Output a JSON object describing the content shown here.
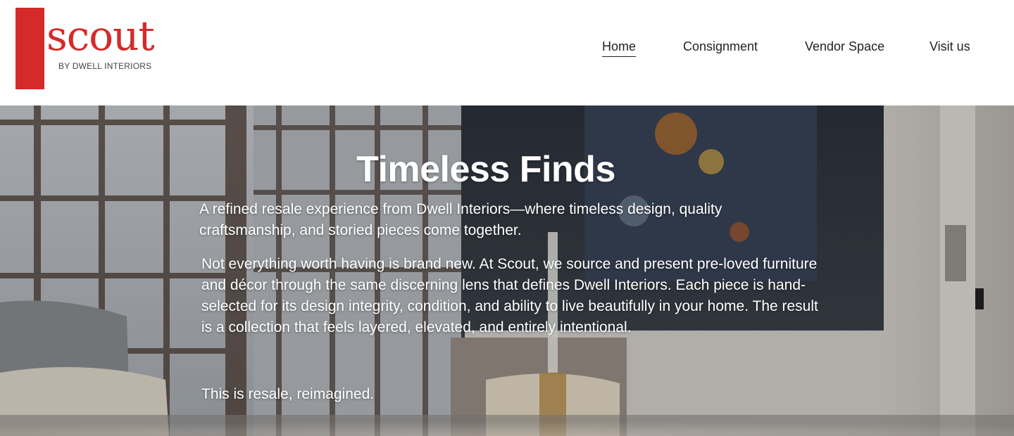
{
  "brand": {
    "logo_word": "scout",
    "logo_subtitle": "BY DWELL INTERIORS",
    "accent_color": "#d52a2a"
  },
  "nav": {
    "items": [
      {
        "label": "Home",
        "active": true
      },
      {
        "label": "Consignment",
        "active": false
      },
      {
        "label": "Vendor Space",
        "active": false
      },
      {
        "label": "Visit us",
        "active": false
      }
    ]
  },
  "hero": {
    "title": "Timeless Finds",
    "lead": "A refined resale experience from Dwell Interiors—where timeless design, quality craftsmanship, and storied pieces come together.",
    "body": "Not everything worth having is brand new. At Scout, we source and present pre-loved furniture and décor through the same discerning lens that defines Dwell Interiors. Each piece is hand-selected for its design integrity, condition, and ability to live beautifully in your home. The result is a collection that feels layered, elevated, and entirely intentional.",
    "tagline": "This is resale, reimagined."
  }
}
